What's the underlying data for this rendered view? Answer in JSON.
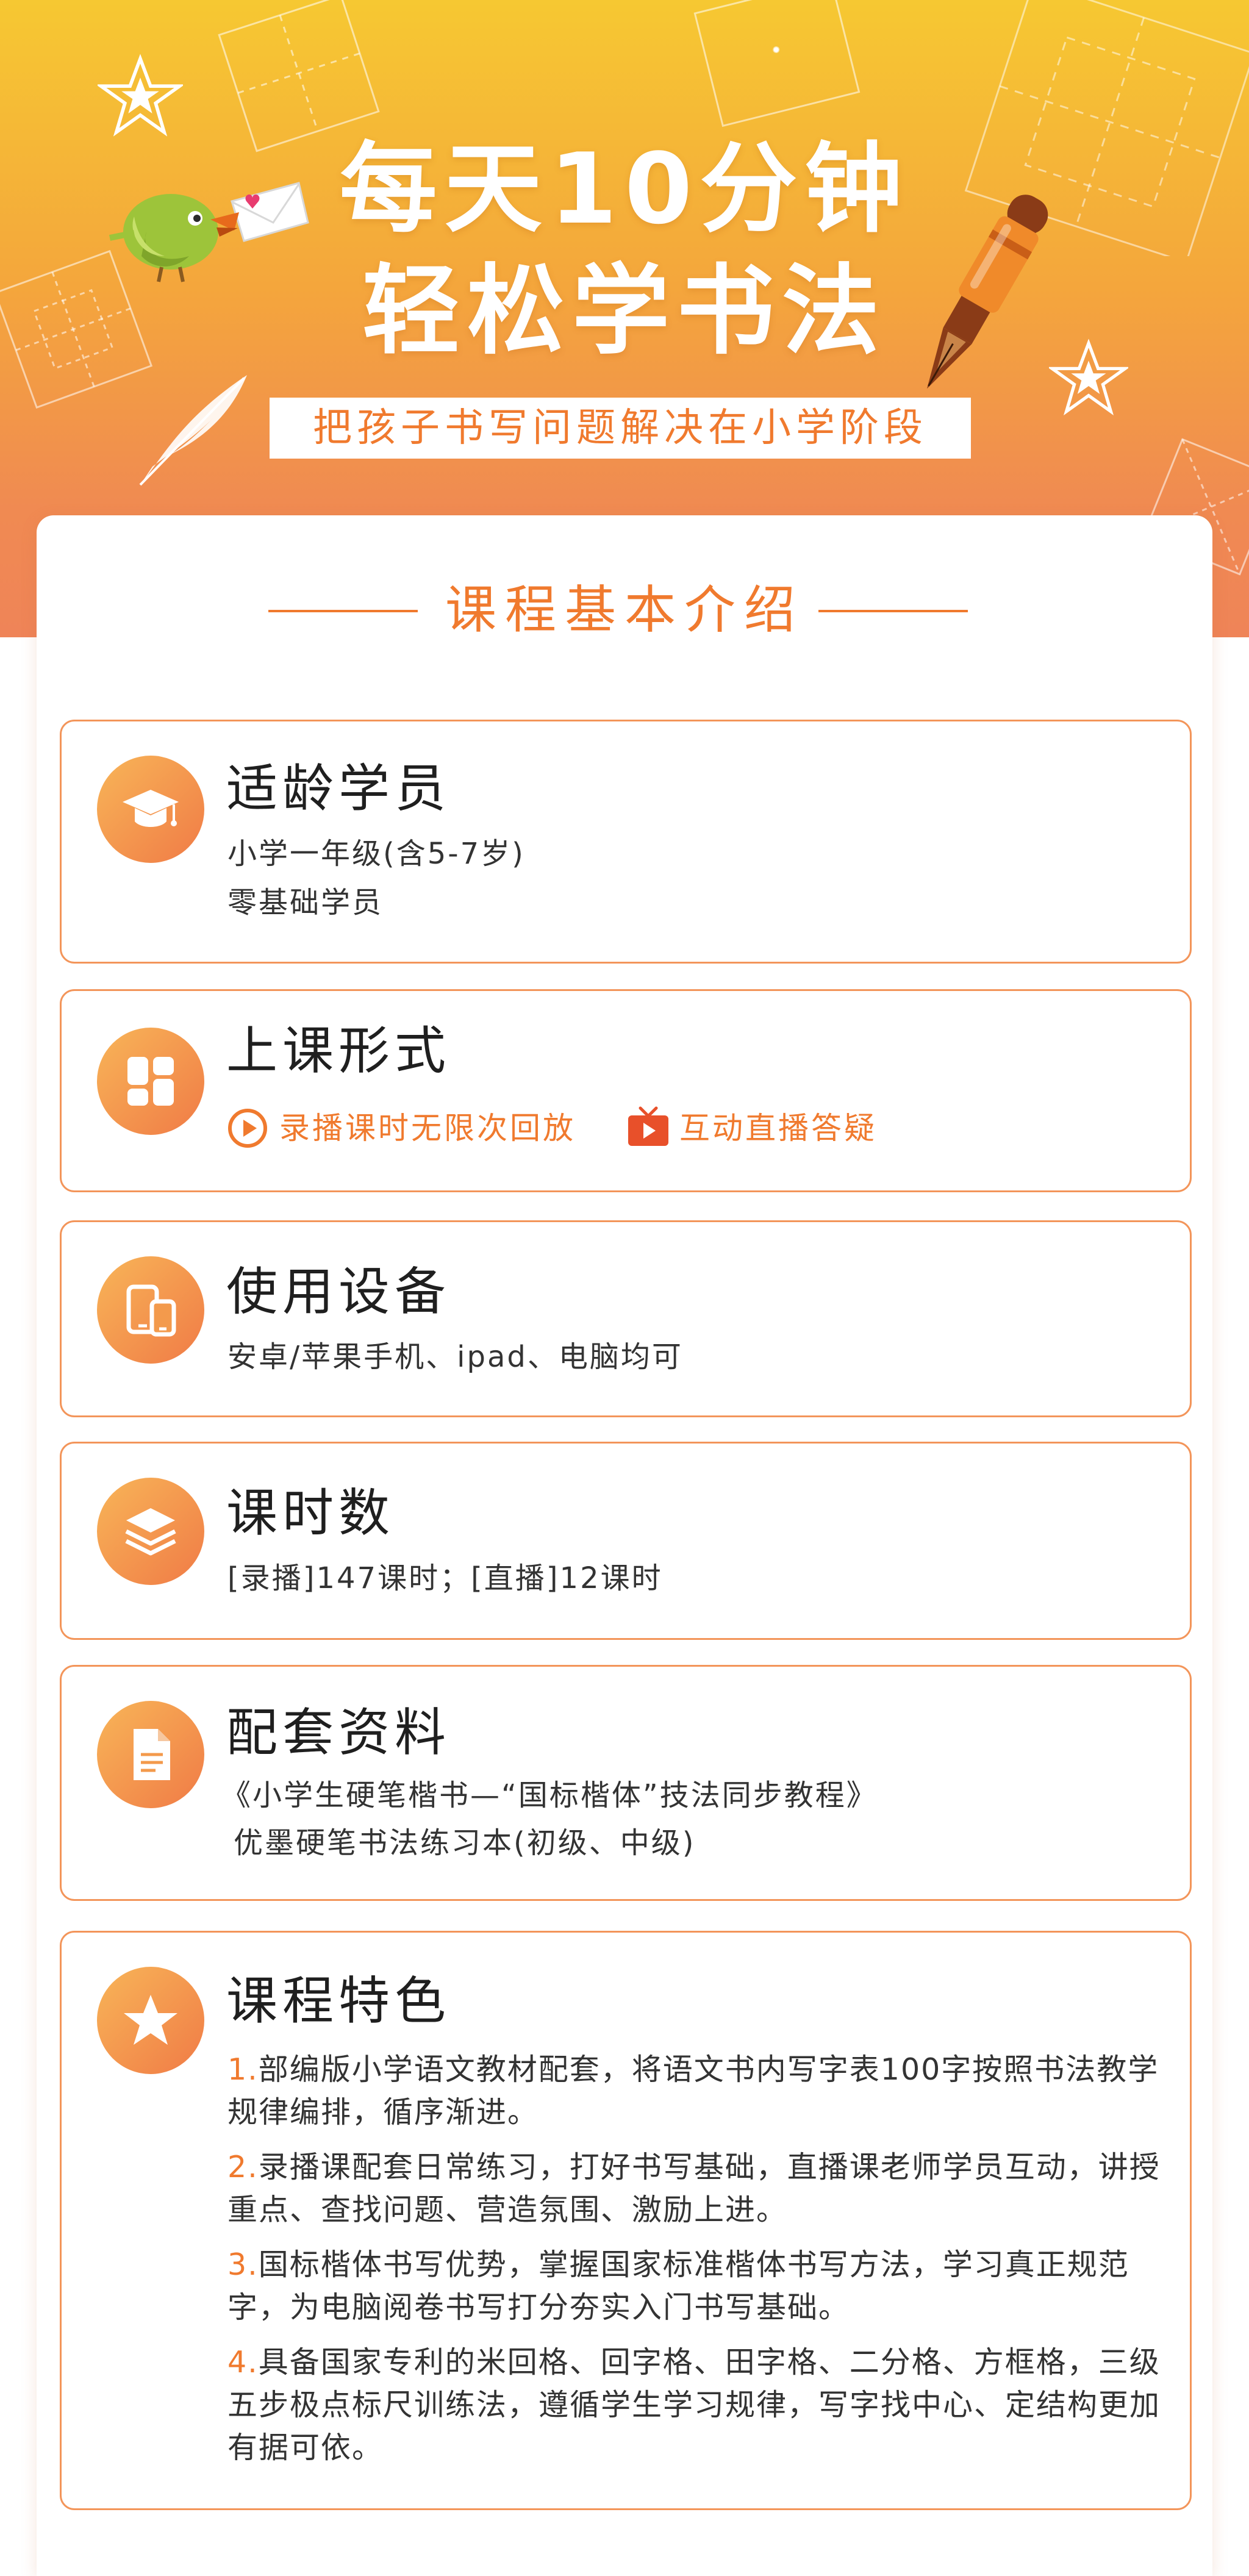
{
  "hero": {
    "title_line1": "每天10分钟",
    "title_line2": "轻松学书法",
    "subtitle": "把孩子书写问题解决在小学阶段"
  },
  "section": {
    "title": "课程基本介绍"
  },
  "colors": {
    "accent": "#f07a2e",
    "header_top": "#f6c832",
    "header_bottom": "#ef8458",
    "border": "#f3955a"
  },
  "cards": [
    {
      "icon": "graduation-cap-icon",
      "title": "适龄学员",
      "lines": [
        "小学一年级(含5-7岁)",
        "零基础学员"
      ]
    },
    {
      "icon": "grid-apps-icon",
      "title": "上课形式",
      "tags": [
        {
          "icon": "play-circle-icon",
          "label": "录播课时无限次回放"
        },
        {
          "icon": "live-tv-icon",
          "label": "互动直播答疑"
        }
      ]
    },
    {
      "icon": "devices-icon",
      "title": "使用设备",
      "lines": [
        "安卓/苹果手机、ipad、电脑均可"
      ]
    },
    {
      "icon": "layers-icon",
      "title": "课时数",
      "lines": [
        "[录播]147课时；[直播]12课时"
      ]
    },
    {
      "icon": "document-icon",
      "title": "配套资料",
      "lines": [
        "《小学生硬笔楷书—“国标楷体”技法同步教程》",
        "优墨硬笔书法练习本(初级、中级)"
      ]
    },
    {
      "icon": "star-icon",
      "title": "课程特色",
      "items": [
        {
          "num": "1.",
          "text": "部编版小学语文教材配套，将语文书内写字表100字按照书法教学规律编排，循序渐进。"
        },
        {
          "num": "2.",
          "text": "录播课配套日常练习，打好书写基础，直播课老师学员互动，讲授重点、查找问题、营造氛围、激励上进。"
        },
        {
          "num": "3.",
          "text": "国标楷体书写优势，掌握国家标准楷体书写方法，学习真正规范字，为电脑阅卷书写打分夯实入门书写基础。"
        },
        {
          "num": "4.",
          "text": "具备国家专利的米回格、回字格、田字格、二分格、方框格，三级五步极点标尺训练法，遵循学生学习规律，写字找中心、定结构更加有据可依。"
        }
      ]
    }
  ]
}
